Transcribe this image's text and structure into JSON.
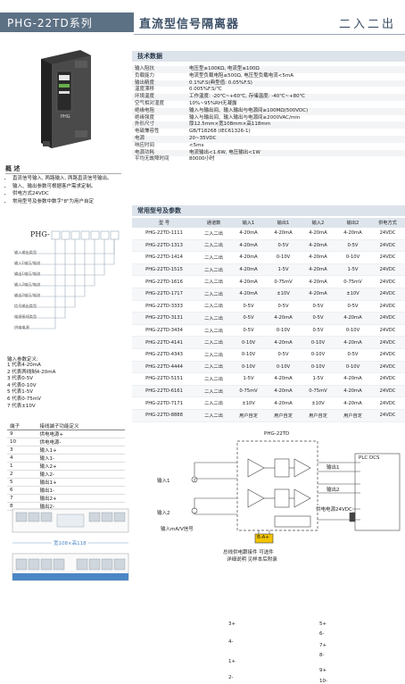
{
  "header": {
    "series": "PHG-22TD系列",
    "title": "直流型信号隔离器",
    "right_label": "二入二出"
  },
  "specs": {
    "band_title": "技术数据",
    "rows": [
      {
        "k": "输入阻抗",
        "v": "电压型≥100KΩ, 电流型≤100Ω"
      },
      {
        "k": "负载能力",
        "v": "电流型负载电阻≤500Ω, 电压型负载电流<5mA"
      },
      {
        "k": "输出精度",
        "v": "0.1%F.S(典型值: 0.05%F.S)"
      },
      {
        "k": "温度漂移",
        "v": "0.005%F.S/℃"
      },
      {
        "k": "环境温度",
        "v": "工作温度: -20℃~+60℃, 存储温度: -40℃~+80℃"
      },
      {
        "k": "空气相对湿度",
        "v": "10%~95%RH无凝露"
      },
      {
        "k": "绝缘电阻",
        "v": "输入与输出间、输入输出与电源间≥100MΩ(500VDC)"
      },
      {
        "k": "绝缘强度",
        "v": "输入与输出间、输入输出与电源间≥2000VAC/min"
      },
      {
        "k": "外形尺寸",
        "v": "厚12.5mm×宽108mm×高118mm"
      },
      {
        "k": "电磁兼容性",
        "v": "GB/T18268 (IEC61326-1)"
      },
      {
        "k": "电源",
        "v": "20~35VDC"
      },
      {
        "k": "响应时间",
        "v": "<5ms"
      },
      {
        "k": "电源功耗",
        "v": "电流输出<1.6W, 电压输出<1W"
      },
      {
        "k": "平均无故障时间",
        "v": "80000小时"
      }
    ]
  },
  "overview": {
    "heading": "概 述",
    "bullets": [
      "直流信号输入, 两路输入, 两路直流信号输出。",
      "输入、输出参数可根据客户需求定制。",
      "供电方式24VDC",
      "常用型号及参数中数字\"8\"为用户自定"
    ]
  },
  "model_code": {
    "prefix": "PHG-",
    "code_labels": [
      "输入输出类型",
      "输入1电压/电流",
      "输出1电压/电流",
      "输入2电压/电流",
      "输出2电压/电流",
      "信号输出类型",
      "电源接线类型",
      "供电电源"
    ],
    "param_title": "输入参数定义:",
    "params": [
      "1 代表4-20mA",
      "2 代表两线制4-20mA",
      "3 代表0-5V",
      "4 代表0-10V",
      "5 代表1-5V",
      "6 代表0-75mV",
      "7 代表±10V"
    ]
  },
  "models": {
    "band_title": "常用型号及参数",
    "headers": [
      "型 号",
      "通道数",
      "输入1",
      "输出1",
      "输入2",
      "输出2",
      "供电方式"
    ],
    "rows": [
      [
        "PHG-22TD-1111",
        "二入二出",
        "4-20mA",
        "4-20mA",
        "4-20mA",
        "4-20mA",
        "24VDC"
      ],
      [
        "PHG-22TD-1313",
        "二入二出",
        "4-20mA",
        "0-5V",
        "4-20mA",
        "0-5V",
        "24VDC"
      ],
      [
        "PHG-22TD-1414",
        "二入二出",
        "4-20mA",
        "0-10V",
        "4-20mA",
        "0-10V",
        "24VDC"
      ],
      [
        "PHG-22TD-1515",
        "二入二出",
        "4-20mA",
        "1-5V",
        "4-20mA",
        "1-5V",
        "24VDC"
      ],
      [
        "PHG-22TD-1616",
        "二入二出",
        "4-20mA",
        "0-75mV",
        "4-20mA",
        "0-75mV",
        "24VDC"
      ],
      [
        "PHG-22TD-1717",
        "二入二出",
        "4-20mA",
        "±10V",
        "4-20mA",
        "±10V",
        "24VDC"
      ],
      [
        "PHG-22TD-3333",
        "二入二出",
        "0-5V",
        "0-5V",
        "0-5V",
        "0-5V",
        "24VDC"
      ],
      [
        "PHG-22TD-3131",
        "二入二出",
        "0-5V",
        "4-20mA",
        "0-5V",
        "4-20mA",
        "24VDC"
      ],
      [
        "PHG-22TD-3434",
        "二入二出",
        "0-5V",
        "0-10V",
        "0-5V",
        "0-10V",
        "24VDC"
      ],
      [
        "PHG-22TD-4141",
        "二入二出",
        "0-10V",
        "4-20mA",
        "0-10V",
        "4-20mA",
        "24VDC"
      ],
      [
        "PHG-22TD-4343",
        "二入二出",
        "0-10V",
        "0-5V",
        "0-10V",
        "0-5V",
        "24VDC"
      ],
      [
        "PHG-22TD-4444",
        "二入二出",
        "0-10V",
        "0-10V",
        "0-10V",
        "0-10V",
        "24VDC"
      ],
      [
        "PHG-22TD-5151",
        "二入二出",
        "1-5V",
        "4-20mA",
        "1-5V",
        "4-20mA",
        "24VDC"
      ],
      [
        "PHG-22TD-6161",
        "二入二出",
        "0-75mV",
        "4-20mA",
        "0-75mV",
        "4-20mA",
        "24VDC"
      ],
      [
        "PHG-22TD-7171",
        "二入二出",
        "±10V",
        "4-20mA",
        "±10V",
        "4-20mA",
        "24VDC"
      ],
      [
        "PHG-22TD-8888",
        "二入二出",
        "用户自定",
        "用户自定",
        "用户自定",
        "用户自定",
        "24VDC"
      ]
    ]
  },
  "terminals": {
    "headers": [
      "端子",
      "接线端子功能定义"
    ],
    "rows": [
      [
        "9",
        "供电电源+"
      ],
      [
        "10",
        "供电电源-"
      ],
      [
        "3",
        "输入1+"
      ],
      [
        "4",
        "输入1-"
      ],
      [
        "1",
        "输入2+"
      ],
      [
        "2",
        "输入2-"
      ],
      [
        "5",
        "输出1+"
      ],
      [
        "6",
        "输出1-"
      ],
      [
        "7",
        "输出2+"
      ],
      [
        "8",
        "输出2-"
      ]
    ]
  },
  "device": {
    "dimension": "宽108×高118"
  },
  "wiring": {
    "device_label": "PHG-22TD",
    "plc_label": "PLC DCS",
    "input1": "输入1",
    "input2": "输入2",
    "input_unit": "输入mA/V信号",
    "output1": "输出1",
    "output2": "输出2",
    "power": "供电电源24VDC",
    "bus": "B-A+",
    "terminals_left": [
      "3+",
      "4-",
      "1+",
      "2-"
    ],
    "terminals_right": [
      "5+",
      "6-",
      "7+",
      "8-",
      "9+",
      "10-"
    ],
    "note1": "总线供电跟接件 可选件",
    "note2": "详细说明 见样本后附录"
  }
}
